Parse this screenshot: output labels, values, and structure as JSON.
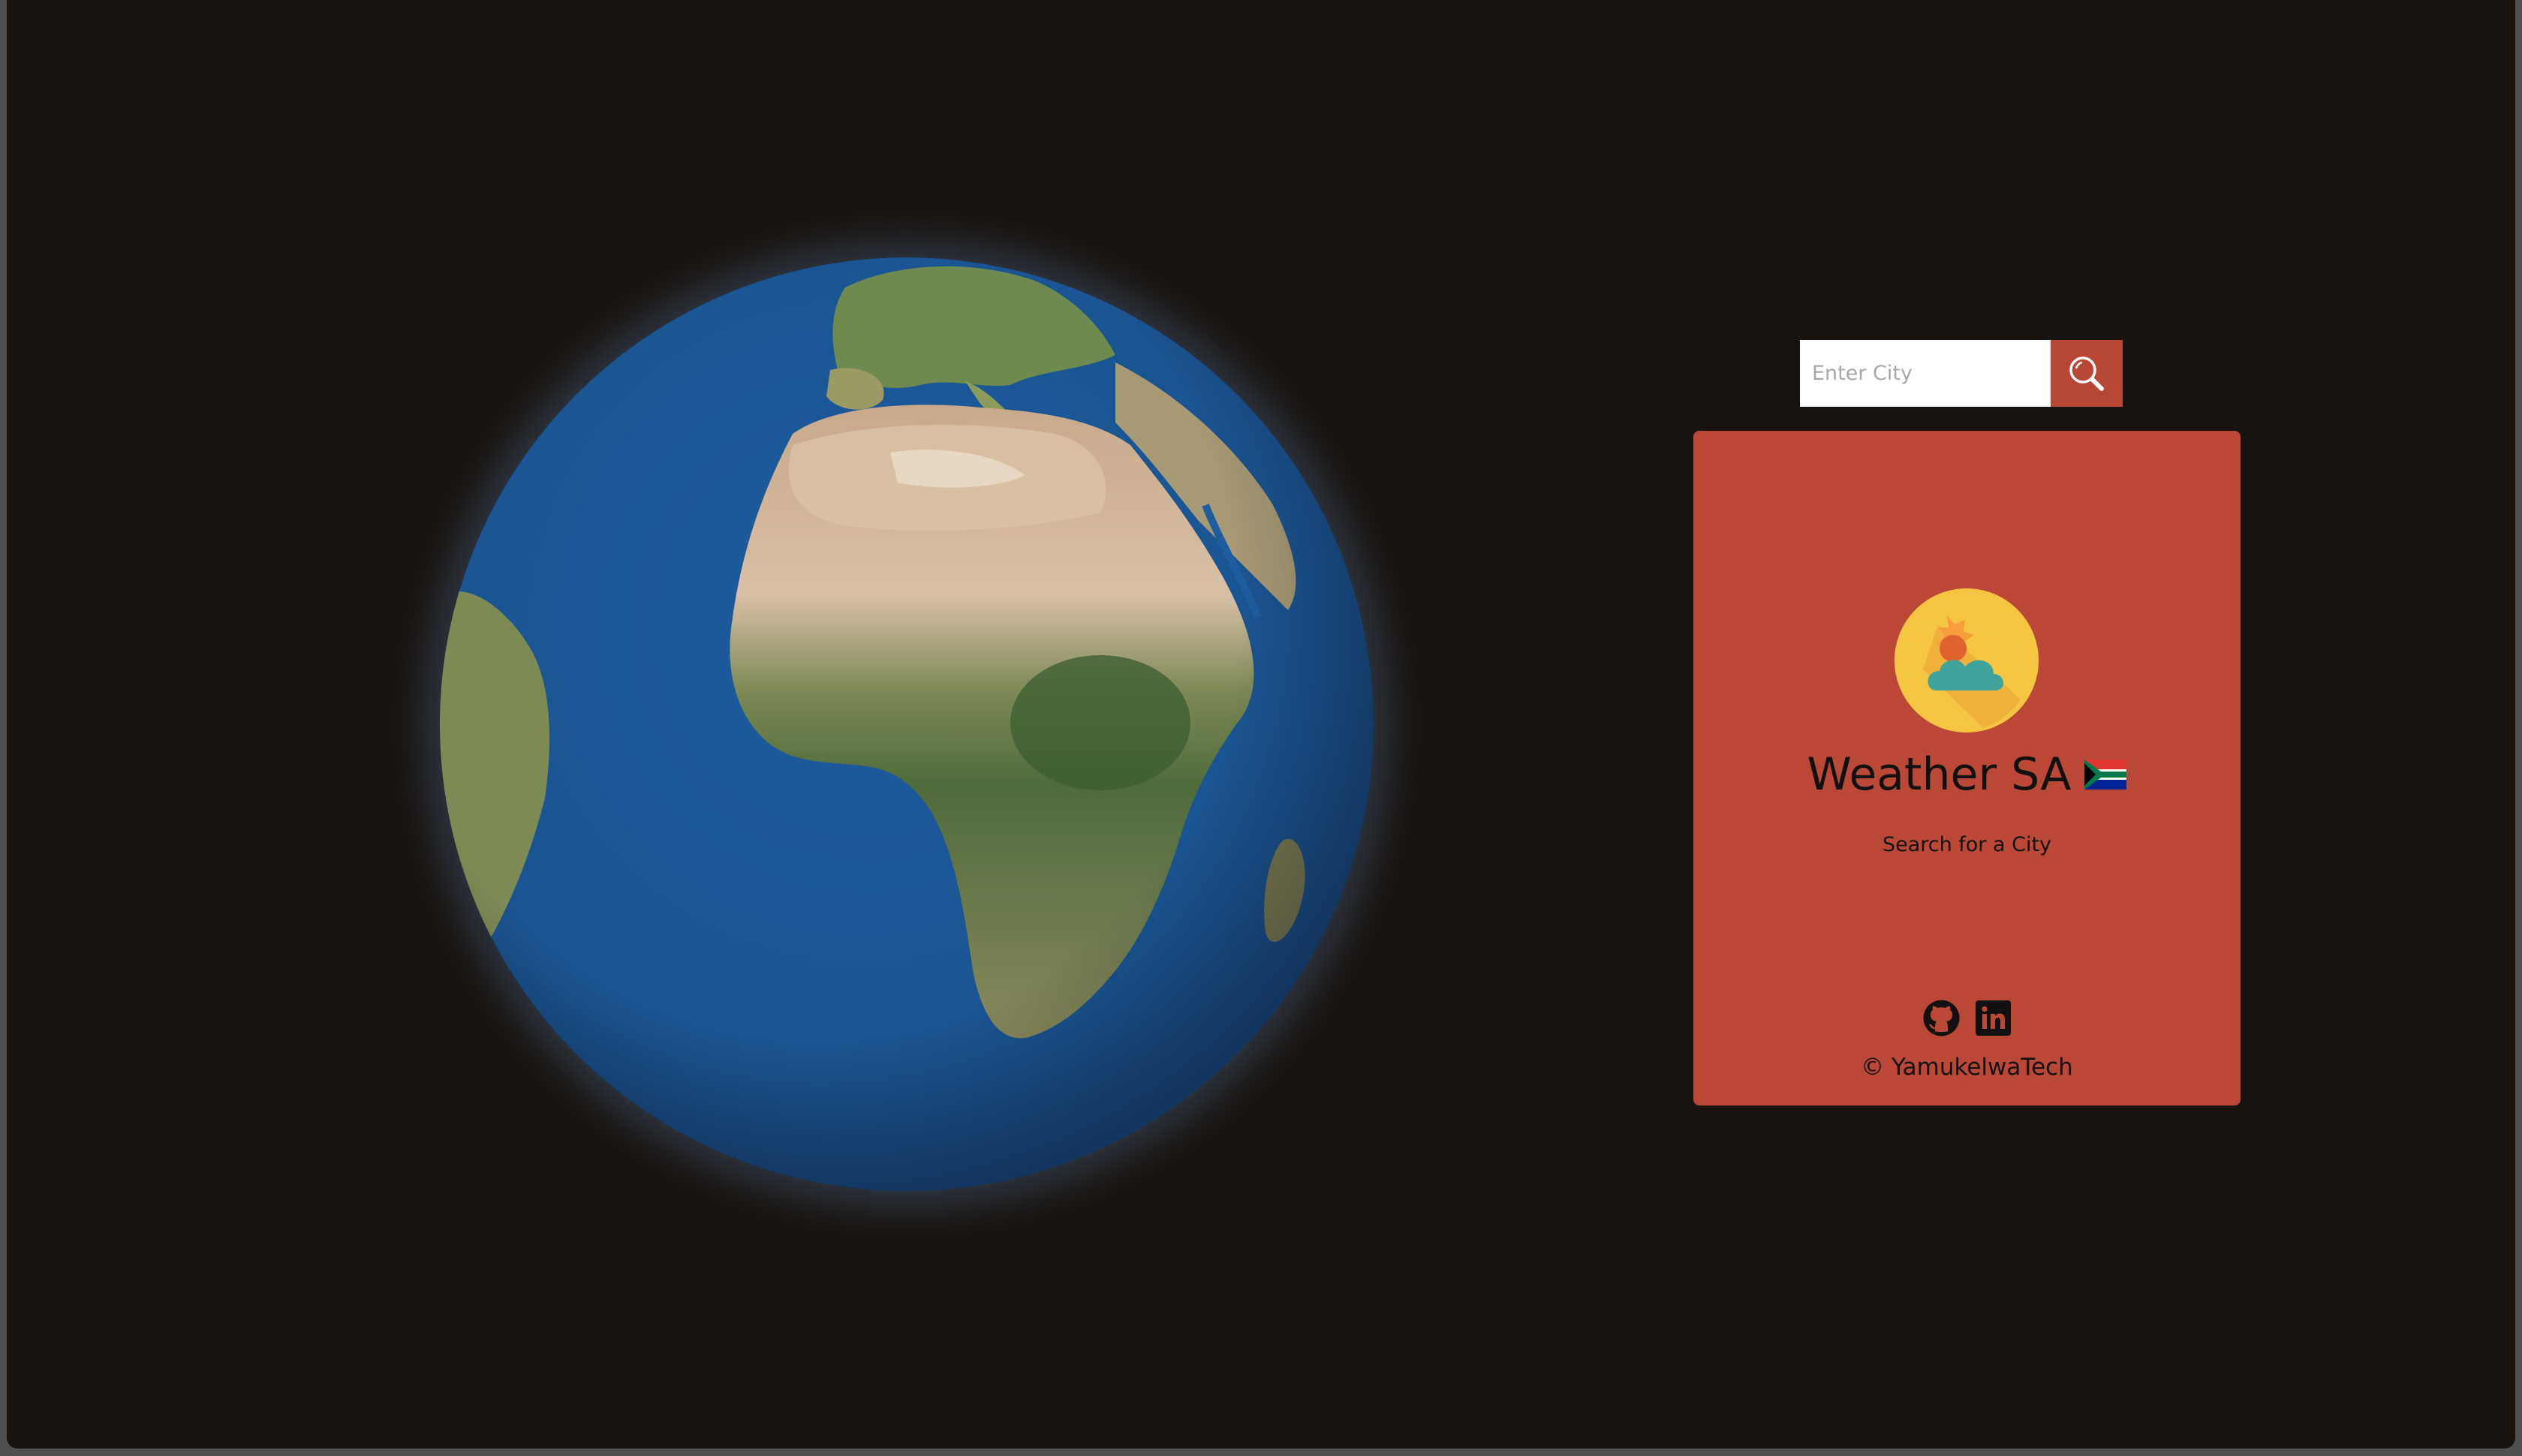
{
  "search": {
    "placeholder": "Enter City",
    "value": "",
    "button_icon": "search-icon"
  },
  "card": {
    "weather_icon": "partly-cloudy-icon",
    "title": "Weather SA",
    "flag": "south-africa-flag-icon",
    "subtitle": "Search for a City",
    "social": [
      "github-icon",
      "linkedin-icon"
    ],
    "footer": "© YamukelwaTech"
  },
  "colors": {
    "background": "#18130f",
    "card": "#bb4836",
    "search_button": "#b84735",
    "icon_circle": "#f6c643",
    "ocean": "#1f5a97"
  }
}
